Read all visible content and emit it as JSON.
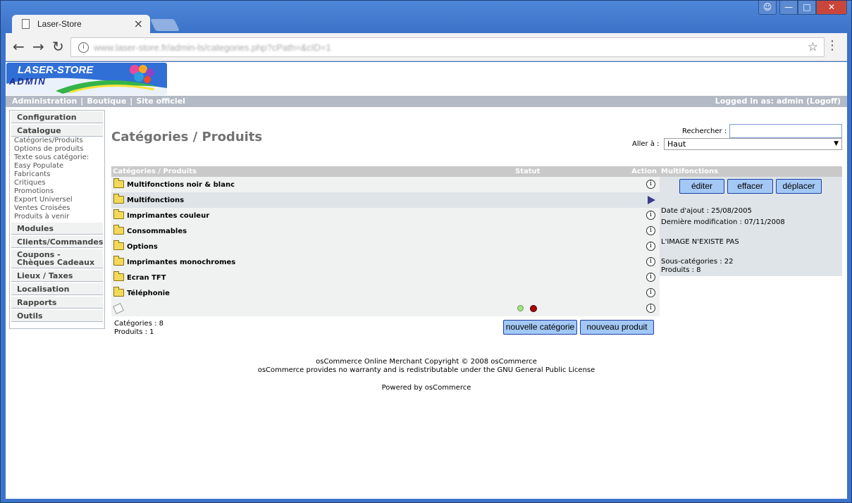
{
  "browser": {
    "tab_title": "Laser-Store",
    "tab_close": "×",
    "url": "www.laser-store.fr/admin-ls/categories.php?cPath=&cID=1"
  },
  "logo": {
    "line1": "LASER-STORE",
    "line2": "ADMIN"
  },
  "header": {
    "links": [
      "Administration",
      "Boutique",
      "Site officiel"
    ],
    "separator": "|",
    "logged_in": "Logged in as: admin (Logoff)"
  },
  "sidebar": {
    "sections": [
      {
        "title": "Configuration",
        "items": []
      },
      {
        "title": "Catalogue",
        "items": [
          "Catégories/Produits",
          "Options de produits",
          "Texte sous catégorie:",
          "Easy Populate",
          "Fabricants",
          "Critiques",
          "Promotions",
          "Export Universel",
          "Ventes Croisées",
          "Produits à venir"
        ]
      },
      {
        "title": "Modules",
        "items": []
      },
      {
        "title": "Clients/Commandes",
        "items": []
      },
      {
        "title": "Coupons - Chèques Cadeaux",
        "items": []
      },
      {
        "title": "Lieux / Taxes",
        "items": []
      },
      {
        "title": "Localisation",
        "items": []
      },
      {
        "title": "Rapports",
        "items": []
      },
      {
        "title": "Outils",
        "items": []
      }
    ]
  },
  "main": {
    "title": "Catégories / Produits",
    "search_label": "Rechercher :",
    "goto_label": "Aller à :",
    "goto_value": "Haut",
    "table_headers": {
      "name": "Catégories / Produits",
      "status": "Statut",
      "action": "Action"
    },
    "categories": [
      "Multifonctions noir & blanc",
      "Multifonctions",
      "Imprimantes couleur",
      "Consommables",
      "Options",
      "Imprimantes monochromes",
      "Ecran TFT",
      "Téléphonie"
    ],
    "selected_index": 1,
    "counts": {
      "categories": "Catégories : 8",
      "products": "Produits : 1"
    },
    "new_category_btn": "nouvelle catégorie",
    "new_product_btn": "nouveau produit"
  },
  "info_panel": {
    "title": "Multifonctions",
    "edit_btn": "éditer",
    "delete_btn": "effacer",
    "move_btn": "déplacer",
    "date_added": "Date d'ajout : 25/08/2005",
    "last_modified": "Dernière modification : 07/11/2008",
    "image_note": "L'IMAGE N'EXISTE PAS",
    "subcategories": "Sous-catégories : 22",
    "products": "Produits : 8"
  },
  "footer": {
    "line1": "osCommerce Online Merchant Copyright © 2008 osCommerce",
    "line2": "osCommerce provides no warranty and is redistributable under the GNU General Public License",
    "line3": "Powered by osCommerce"
  },
  "colors": {
    "header_bar": "#b3bac5",
    "button_fill": "#a4c8f5",
    "button_border": "#1b3fa8",
    "row_bg": "#f0f1f1",
    "selected_row_bg": "#dee4e8",
    "status_active": "#a8e08a",
    "status_inactive": "#b10000"
  }
}
